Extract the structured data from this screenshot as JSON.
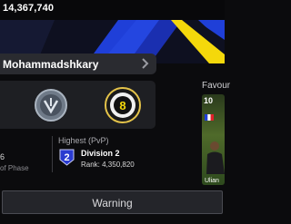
{
  "header": {
    "coins": "14,367,740"
  },
  "profile": {
    "name": "Mohammadshkary"
  },
  "stats": {
    "left_value": "6",
    "left_label": "of Phase",
    "highest_label": "Highest (PvP)",
    "division": "Division 2",
    "rank": "Rank: 4,350,820"
  },
  "emblems": {
    "badge_number": "8"
  },
  "favourite": {
    "label": "Favour",
    "rating": "10",
    "player_name": "Ulian"
  },
  "warning_button": "Warning",
  "colors": {
    "banner_yellow": "#f4d80b",
    "banner_blue": "#1f3fd8",
    "card_green": "#4f6a2a"
  }
}
